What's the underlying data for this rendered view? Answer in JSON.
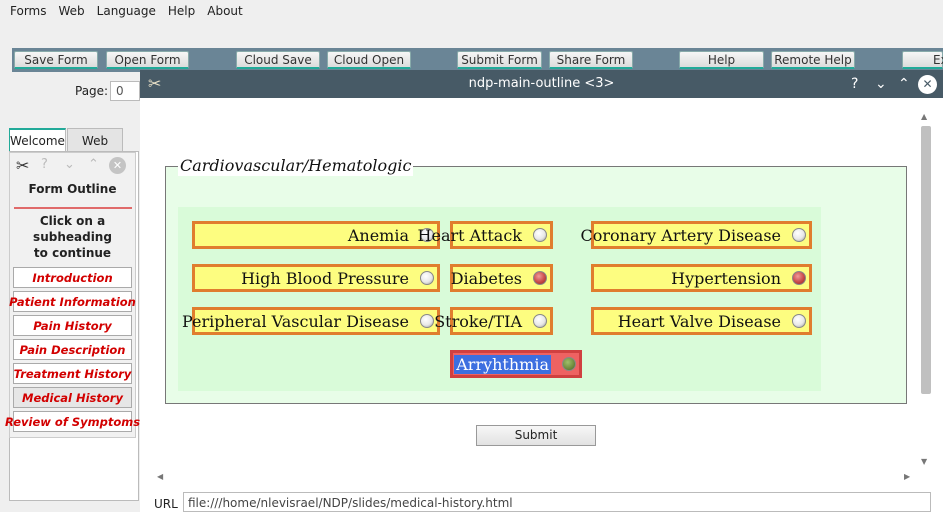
{
  "menu": [
    "Forms",
    "Web",
    "Language",
    "Help",
    "About"
  ],
  "toolbar": {
    "buttons": [
      "Save Form",
      "Open Form",
      "Cloud Save",
      "Cloud Open",
      "Submit Form",
      "Share Form",
      "Help",
      "Remote Help",
      "Ex"
    ]
  },
  "page": {
    "label": "Page:",
    "value": "0"
  },
  "left_tabs": [
    "Welcome",
    "Web"
  ],
  "outline": {
    "title": "Form Outline",
    "note_lines": [
      "Click on a",
      "subheading",
      "to continue"
    ],
    "items": [
      "Introduction",
      "Patient Information",
      "Pain History",
      "Pain Description",
      "Treatment History",
      "Medical History",
      "Review of Symptoms"
    ],
    "active_item": "Medical History",
    "icons": {
      "help": "?",
      "minimize": "⌄",
      "maximize": "⌃",
      "close": "✕"
    }
  },
  "window": {
    "title": "ndp-main-outline <3>",
    "controls": {
      "help": "?",
      "minimize": "⌄",
      "maximize": "⌃",
      "close": "✕"
    }
  },
  "form": {
    "section_title": "Cardiovascular/Hematologic",
    "conditions": [
      {
        "label": "Anemia",
        "checked": false
      },
      {
        "label": "Heart Attack",
        "checked": false
      },
      {
        "label": "Coronary Artery Disease",
        "checked": false
      },
      {
        "label": "High Blood Pressure",
        "checked": false
      },
      {
        "label": "Diabetes",
        "checked": true
      },
      {
        "label": "Hypertension",
        "checked": true
      },
      {
        "label": "Peripheral Vascular Disease",
        "checked": false
      },
      {
        "label": "Stroke/TIA",
        "checked": false
      },
      {
        "label": "Heart Valve Disease",
        "checked": false
      },
      {
        "label": "Arryhthmia",
        "checked": false,
        "focused": true
      }
    ],
    "submit_label": "Submit"
  },
  "url": {
    "label": "URL",
    "value": "file:///home/nlevisrael/NDP/slides/medical-history.html"
  },
  "colors": {
    "title_bar": "#475a66",
    "checkbox_fill": "#fdfd80",
    "checkbox_border": "#e07d2e",
    "section_bg": "#e8fde8",
    "outline_link": "#d20000",
    "selection": "#3d6fe0"
  }
}
